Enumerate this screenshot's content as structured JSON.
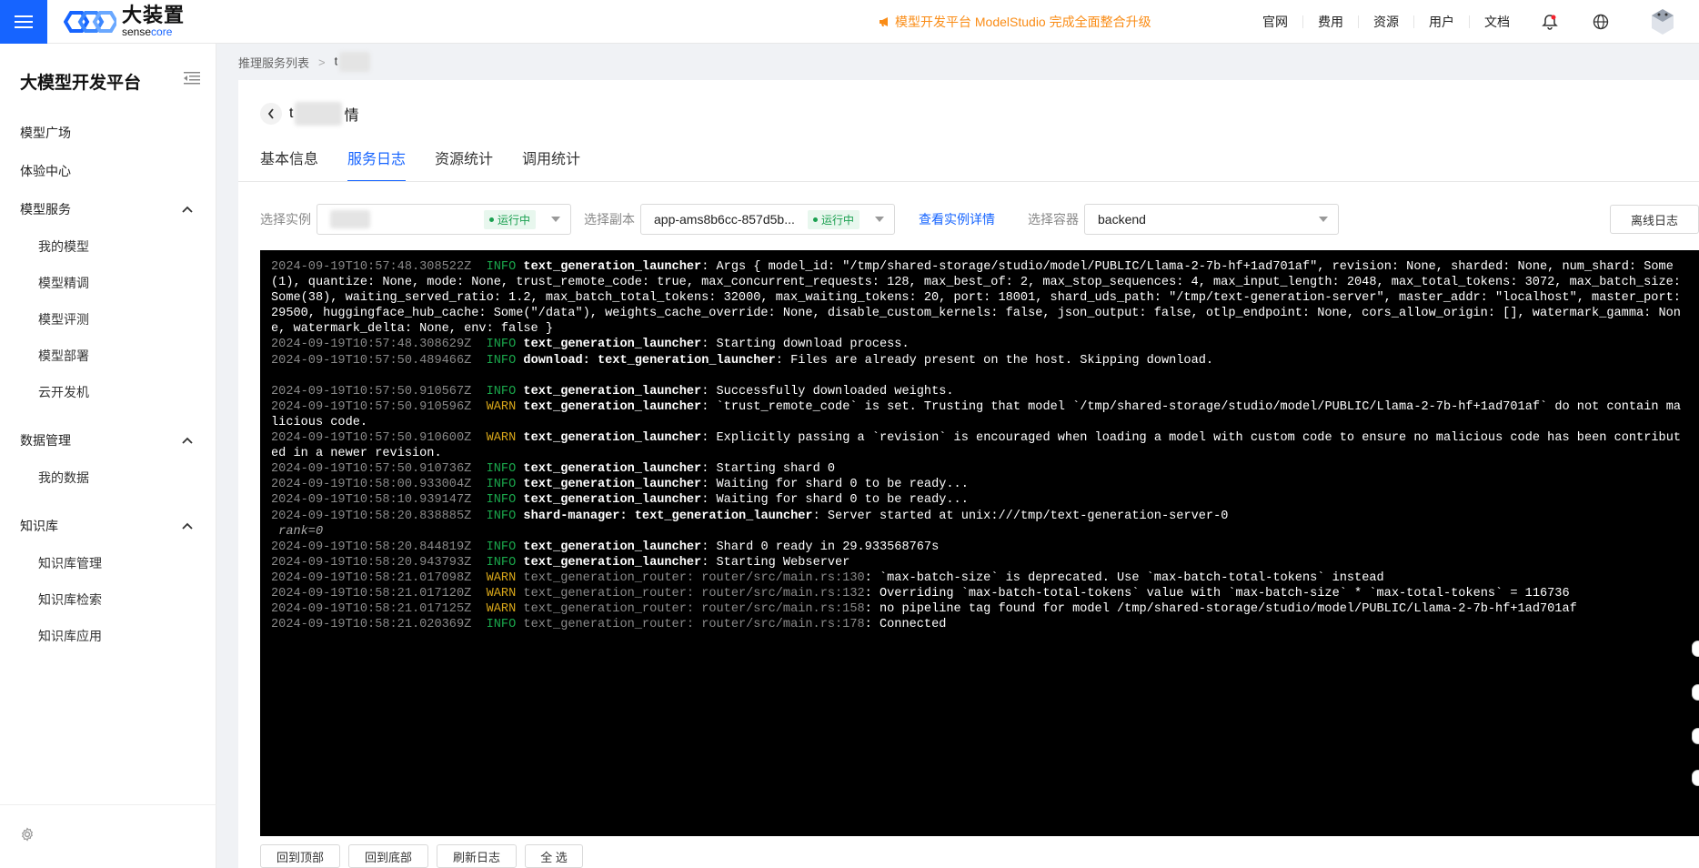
{
  "brand": {
    "name_cn": "大装置",
    "name_en_a": "sense",
    "name_en_b": "core",
    "accent": "#1664ff"
  },
  "announcement": "模型开发平台 ModelStudio 完成全面整合升级",
  "topnav": {
    "links": [
      "官网",
      "费用",
      "资源",
      "用户",
      "文档"
    ],
    "icons": [
      "bell-icon",
      "globe-icon",
      "avatar"
    ]
  },
  "sidebar": {
    "title": "大模型开发平台",
    "top_items": [
      "模型广场",
      "体验中心"
    ],
    "groups": [
      {
        "label": "模型服务",
        "items": [
          "我的模型",
          "模型精调",
          "模型评测",
          "模型部署",
          "云开发机"
        ]
      },
      {
        "label": "数据管理",
        "items": [
          "我的数据"
        ]
      },
      {
        "label": "知识库",
        "items": [
          "知识库管理",
          "知识库检索",
          "知识库应用"
        ]
      }
    ]
  },
  "breadcrumb": {
    "root": "推理服务列表",
    "current": "t"
  },
  "page": {
    "title_prefix": "t",
    "title_suffix": "情"
  },
  "tabs": [
    "基本信息",
    "服务日志",
    "资源统计",
    "调用统计"
  ],
  "active_tab": "服务日志",
  "filters": {
    "instance_label": "选择实例",
    "instance_status": "运行中",
    "replica_label": "选择副本",
    "replica_value": "app-ams8b6cc-857d5b...",
    "replica_status": "运行中",
    "detail_link": "查看实例详情",
    "container_label": "选择容器",
    "container_value": "backend",
    "offline_logs": "离线日志"
  },
  "logs": [
    {
      "ts": "2024-09-19T10:57:48.308522Z",
      "level": "INFO",
      "target": "text_generation_launcher",
      "target_style": "bold",
      "msg": ": Args { model_id: \"/tmp/shared-storage/studio/model/PUBLIC/Llama-2-7b-hf+1ad701af\", revision: None, sharded: None, num_shard: Some(1), quantize: None, mode: None, trust_remote_code: true, max_concurrent_requests: 128, max_best_of: 2, max_stop_sequences: 4, max_input_length: 2048, max_total_tokens: 3072, max_batch_size: Some(38), waiting_served_ratio: 1.2, max_batch_total_tokens: 32000, max_waiting_tokens: 20, port: 18001, shard_uds_path: \"/tmp/text-generation-server\", master_addr: \"localhost\", master_port: 29500, huggingface_hub_cache: Some(\"/data\"), weights_cache_override: None, disable_custom_kernels: false, json_output: false, otlp_endpoint: None, cors_allow_origin: [], watermark_gamma: None, watermark_delta: None, env: false }"
    },
    {
      "ts": "2024-09-19T10:57:48.308629Z",
      "level": "INFO",
      "target": "text_generation_launcher",
      "target_style": "bold",
      "msg": ": Starting download process."
    },
    {
      "ts": "2024-09-19T10:57:50.489466Z",
      "level": "INFO",
      "target": "download: text_generation_launcher",
      "target_style": "bold",
      "msg": ": Files are already present on the host. Skipping download."
    },
    {
      "ts": "",
      "level": "",
      "target": "",
      "target_style": "",
      "msg": " "
    },
    {
      "ts": "2024-09-19T10:57:50.910567Z",
      "level": "INFO",
      "target": "text_generation_launcher",
      "target_style": "bold",
      "msg": ": Successfully downloaded weights."
    },
    {
      "ts": "2024-09-19T10:57:50.910596Z",
      "level": "WARN",
      "target": "text_generation_launcher",
      "target_style": "bold",
      "msg": ": `trust_remote_code` is set. Trusting that model `/tmp/shared-storage/studio/model/PUBLIC/Llama-2-7b-hf+1ad701af` do not contain malicious code."
    },
    {
      "ts": "2024-09-19T10:57:50.910600Z",
      "level": "WARN",
      "target": "text_generation_launcher",
      "target_style": "bold",
      "msg": ": Explicitly passing a `revision` is encouraged when loading a model with custom code to ensure no malicious code has been contributed in a newer revision."
    },
    {
      "ts": "2024-09-19T10:57:50.910736Z",
      "level": "INFO",
      "target": "text_generation_launcher",
      "target_style": "bold",
      "msg": ": Starting shard 0"
    },
    {
      "ts": "2024-09-19T10:58:00.933004Z",
      "level": "INFO",
      "target": "text_generation_launcher",
      "target_style": "bold",
      "msg": ": Waiting for shard 0 to be ready..."
    },
    {
      "ts": "2024-09-19T10:58:10.939147Z",
      "level": "INFO",
      "target": "text_generation_launcher",
      "target_style": "bold",
      "msg": ": Waiting for shard 0 to be ready..."
    },
    {
      "ts": "2024-09-19T10:58:20.838885Z",
      "level": "INFO",
      "target": "shard-manager: text_generation_launcher",
      "target_style": "bold",
      "msg": ": Server started at unix:///tmp/text-generation-server-0"
    },
    {
      "ts": "",
      "level": "",
      "target": "",
      "target_style": "",
      "msg": " rank=0",
      "rank": true
    },
    {
      "ts": "2024-09-19T10:58:20.844819Z",
      "level": "INFO",
      "target": "text_generation_launcher",
      "target_style": "bold",
      "msg": ": Shard 0 ready in 29.933568767s"
    },
    {
      "ts": "2024-09-19T10:58:20.943793Z",
      "level": "INFO",
      "target": "text_generation_launcher",
      "target_style": "bold",
      "msg": ": Starting Webserver"
    },
    {
      "ts": "2024-09-19T10:58:21.017098Z",
      "level": "WARN",
      "target": "text_generation_router: router/src/main.rs:130",
      "target_style": "dim",
      "msg": ": `max-batch-size` is deprecated. Use `max-batch-total-tokens` instead"
    },
    {
      "ts": "2024-09-19T10:58:21.017120Z",
      "level": "WARN",
      "target": "text_generation_router: router/src/main.rs:132",
      "target_style": "dim",
      "msg": ": Overriding `max-batch-total-tokens` value with `max-batch-size` * `max-total-tokens` = 116736"
    },
    {
      "ts": "2024-09-19T10:58:21.017125Z",
      "level": "WARN",
      "target": "text_generation_router: router/src/main.rs:158",
      "target_style": "dim",
      "msg": ": no pipeline tag found for model /tmp/shared-storage/studio/model/PUBLIC/Llama-2-7b-hf+1ad701af"
    },
    {
      "ts": "2024-09-19T10:58:21.020369Z",
      "level": "INFO",
      "target": "text_generation_router: router/src/main.rs:178",
      "target_style": "dim",
      "msg": ": Connected"
    }
  ],
  "bottom_buttons": [
    "回到顶部",
    "回到底部",
    "刷新日志",
    "全 选"
  ]
}
